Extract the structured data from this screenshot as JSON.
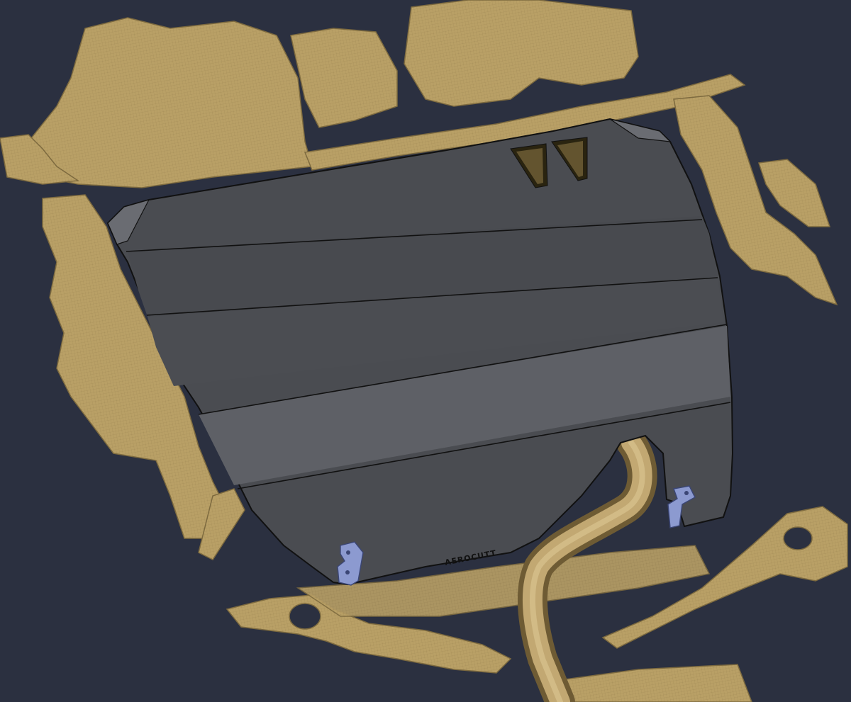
{
  "scene": {
    "background_color": "#2b3040",
    "scan_color": "#b9a066",
    "scan_shadow_color": "#7d6a3f",
    "plate_color": "#4a4c51",
    "plate_highlight_color": "#5e6066",
    "bracket_color": "#8c9ad0"
  },
  "plate": {
    "brand_label": "AEROCUTT",
    "panel_count": 5,
    "mounting_brackets": 2
  }
}
